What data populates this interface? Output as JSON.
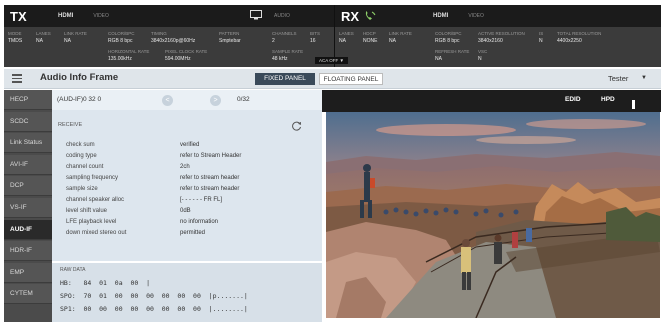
{
  "tx": {
    "badge": "TX",
    "hdmi": "HDMI",
    "video": "VIDEO",
    "audio": "AUDIO",
    "fields": [
      {
        "label": "MODE",
        "value": "TMDS"
      },
      {
        "label": "LANES",
        "value": "NA"
      },
      {
        "label": "LINK RATE",
        "value": "NA"
      },
      {
        "label": "COLOR/BPC",
        "value": "RGB 8 bpc"
      },
      {
        "label": "TIMING",
        "value": "3840x2160p@60Hz"
      },
      {
        "label": "PATTERN",
        "value": "Smptebar"
      },
      {
        "label": "HORIZONTAL RATE",
        "value": "135.00kHz"
      },
      {
        "label": "PIXEL CLOCK RATE",
        "value": "594.00MHz"
      },
      {
        "label": "CHANNELS",
        "value": "2"
      },
      {
        "label": "BITS",
        "value": "16"
      },
      {
        "label": "SAMPLE RATE",
        "value": "48 kHz"
      }
    ],
    "aca": "ACA OFF ▼"
  },
  "rx": {
    "badge": "RX",
    "hdmi": "HDMI",
    "video": "VIDEO",
    "fields": [
      {
        "label": "LANES",
        "value": "NA"
      },
      {
        "label": "HDCP",
        "value": "NONE"
      },
      {
        "label": "LINK RATE",
        "value": "NA"
      },
      {
        "label": "COLOR/BPC",
        "value": "RGB 8 bpc"
      },
      {
        "label": "ACTIVE RESOLUTION",
        "value": "3840x2160"
      },
      {
        "label": "IS",
        "value": "N"
      },
      {
        "label": "TOTAL RESOLUTION",
        "value": "4400x2250"
      },
      {
        "label": "REFRESH RATE",
        "value": "NA"
      },
      {
        "label": "VSC",
        "value": "N"
      }
    ]
  },
  "toolbar": {
    "title": "Audio Info Frame",
    "tab_fixed": "FIXED PANEL",
    "tab_floating": "FLOATING PANEL",
    "user": "Tester",
    "caret": "▼"
  },
  "sidebar": {
    "items": [
      "HECP",
      "SCDC",
      "Link Status",
      "AVI-IF",
      "DCP",
      "VS-IF",
      "AUD-IF",
      "HDR-IF",
      "EMP",
      "CYTEM"
    ],
    "active": "AUD-IF"
  },
  "panel": {
    "id": "(AUD-IF)0 32 0",
    "prev": "<",
    "next": ">",
    "counter": "0/32",
    "section": "RECEIVE",
    "fields": [
      {
        "label": "check sum",
        "value": "verified"
      },
      {
        "label": "coding type",
        "value": "refer to Stream Header"
      },
      {
        "label": "channel count",
        "value": "2ch"
      },
      {
        "label": "sampling frequency",
        "value": "refer to stream header"
      },
      {
        "label": "sample size",
        "value": "refer to stream header"
      },
      {
        "label": "channel speaker alloc",
        "value": "[- - - - - -   FR FL]"
      },
      {
        "label": "level shift value",
        "value": "0dB"
      },
      {
        "label": "LFE playback level",
        "value": "no information"
      },
      {
        "label": "down mixed stereo out",
        "value": "permitted"
      }
    ],
    "raw_title": "RAW DATA",
    "raw_lines": [
      "HB:   84  01  0a  00  |",
      "SPO:  70  01  00  00  00  00  00  00  |p.......|",
      "SP1:  00  00  00  00  00  00  00  00  |........|"
    ]
  },
  "video_bar": {
    "edid": "EDID",
    "hpd": "HPD"
  },
  "colors": {
    "header_dark": "#1b1b1b",
    "header_mid": "#3b3b3b",
    "sidebar": "#4b4b4b",
    "sidebar_active": "#2a2a2a",
    "panel_bg": "#dde6ee",
    "toolbar_bg": "#dfe5ea",
    "tab_active": "#3a4a5a",
    "phone_icon": "#8fd16a"
  }
}
